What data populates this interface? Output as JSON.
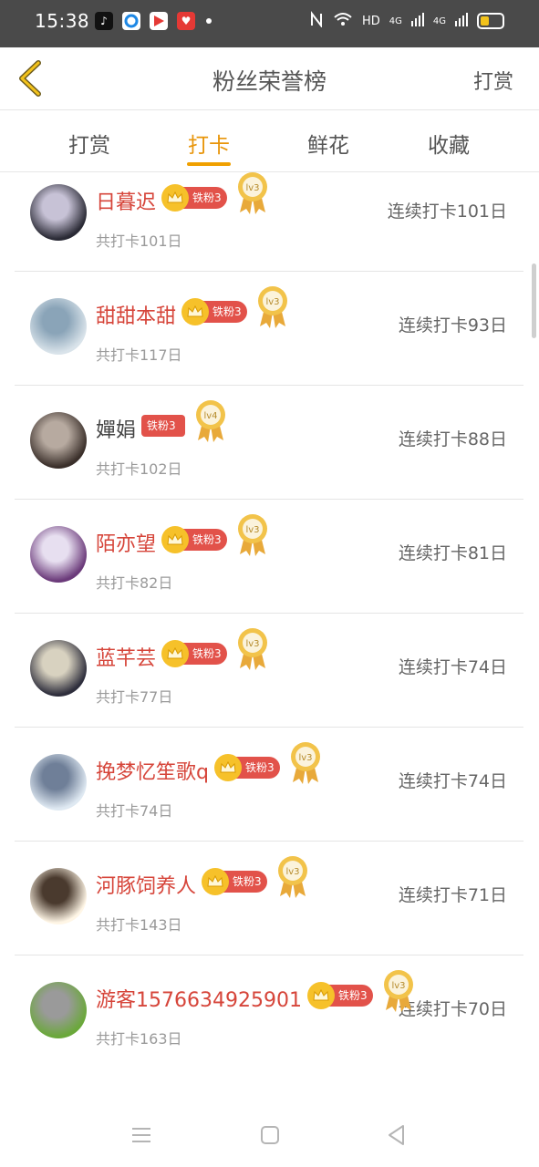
{
  "status_bar": {
    "time": "15:38",
    "network_label": "HD",
    "sim1": "4G",
    "sim2": "4G"
  },
  "header": {
    "title": "粉丝荣誉榜",
    "action": "打赏"
  },
  "tabs": [
    {
      "label": "打赏",
      "active": false
    },
    {
      "label": "打卡",
      "active": true
    },
    {
      "label": "鲜花",
      "active": false
    },
    {
      "label": "收藏",
      "active": false
    }
  ],
  "colors": {
    "accent": "#f0a000",
    "name_red": "#d6453a",
    "badge_red": "#e2524a",
    "crown_gold": "#f6c12a"
  },
  "fans": [
    {
      "name": "日暮迟",
      "total": "共打卡101日",
      "streak": "连续打卡101日",
      "badge": "铁粉3",
      "level": "lv3",
      "crown": true
    },
    {
      "name": "甜甜本甜",
      "total": "共打卡117日",
      "streak": "连续打卡93日",
      "badge": "铁粉3",
      "level": "lv3",
      "crown": true
    },
    {
      "name": "嬋娟",
      "total": "共打卡102日",
      "streak": "连续打卡88日",
      "badge": "铁粉3",
      "level": "lv4",
      "crown": false
    },
    {
      "name": "陌亦望",
      "total": "共打卡82日",
      "streak": "连续打卡81日",
      "badge": "铁粉3",
      "level": "lv3",
      "crown": true
    },
    {
      "name": "蓝芊芸",
      "total": "共打卡77日",
      "streak": "连续打卡74日",
      "badge": "铁粉3",
      "level": "lv3",
      "crown": true
    },
    {
      "name": "挽梦忆笙歌q",
      "total": "共打卡74日",
      "streak": "连续打卡74日",
      "badge": "铁粉3",
      "level": "lv3",
      "crown": true
    },
    {
      "name": "河豚饲养人",
      "total": "共打卡143日",
      "streak": "连续打卡71日",
      "badge": "铁粉3",
      "level": "lv3",
      "crown": true
    },
    {
      "name": "游客1576634925901",
      "total": "共打卡163日",
      "streak": "连续打卡70日",
      "badge": "铁粉3",
      "level": "lv3",
      "crown": true
    }
  ]
}
